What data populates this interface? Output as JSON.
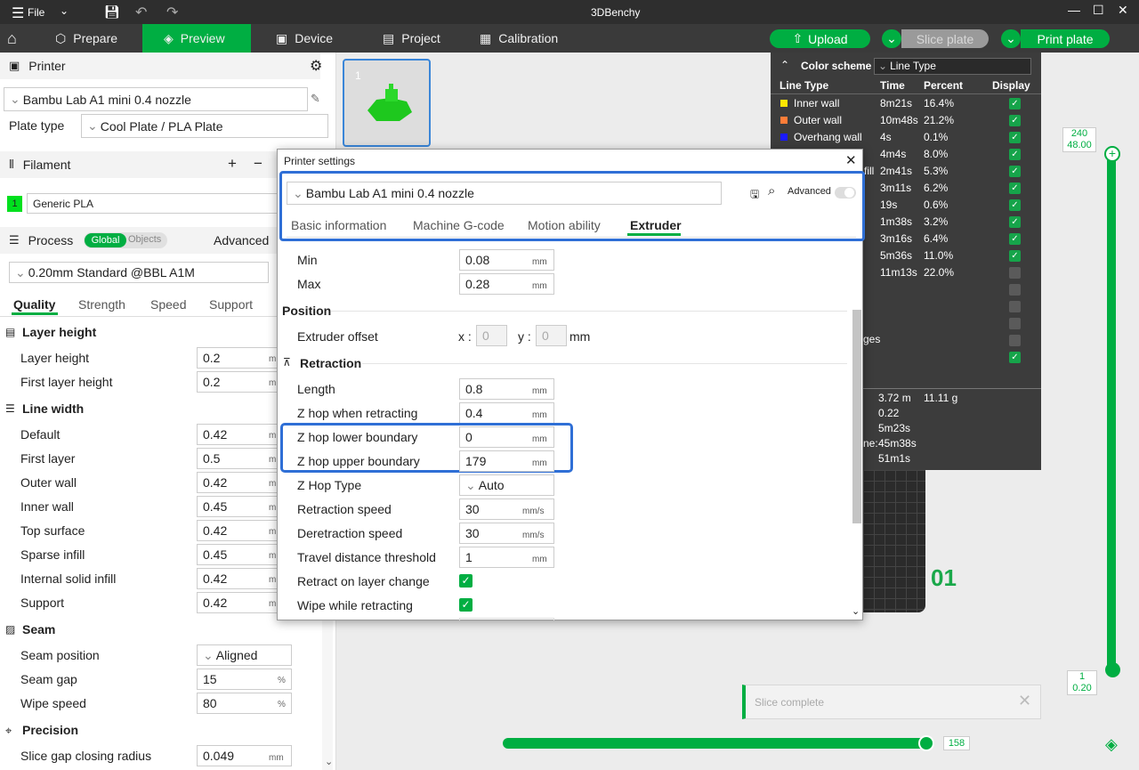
{
  "app": {
    "title": "3DBenchy",
    "file_menu": "File"
  },
  "tabs": [
    {
      "label": "Prepare"
    },
    {
      "label": "Preview"
    },
    {
      "label": "Device"
    },
    {
      "label": "Project"
    },
    {
      "label": "Calibration"
    }
  ],
  "actions": {
    "upload": "Upload",
    "slice_plate": "Slice plate",
    "print_plate": "Print plate"
  },
  "printer": {
    "header": "Printer",
    "name": "Bambu Lab A1 mini 0.4 nozzle",
    "plate_type_label": "Plate type",
    "plate_type_value": "Cool Plate / PLA Plate"
  },
  "filament": {
    "header": "Filament",
    "slot": "1",
    "name": "Generic PLA"
  },
  "process": {
    "header": "Process",
    "global": "Global",
    "objects": "Objects",
    "advanced": "Advanced",
    "preset": "0.20mm Standard @BBL A1M",
    "tabs": [
      "Quality",
      "Strength",
      "Speed",
      "Support"
    ]
  },
  "quality": {
    "layer_height_group": "Layer height",
    "layer_height_label": "Layer height",
    "layer_height_value": "0.2",
    "first_layer_height_label": "First layer height",
    "first_layer_height_value": "0.2",
    "line_width_group": "Line width",
    "lw": [
      {
        "label": "Default",
        "value": "0.42"
      },
      {
        "label": "First layer",
        "value": "0.5"
      },
      {
        "label": "Outer wall",
        "value": "0.42"
      },
      {
        "label": "Inner wall",
        "value": "0.45"
      },
      {
        "label": "Top surface",
        "value": "0.42"
      },
      {
        "label": "Sparse infill",
        "value": "0.45"
      },
      {
        "label": "Internal solid infill",
        "value": "0.42"
      },
      {
        "label": "Support",
        "value": "0.42"
      }
    ],
    "unit_mm": "mm",
    "seam_group": "Seam",
    "seam_position_label": "Seam position",
    "seam_position_value": "Aligned",
    "seam_gap_label": "Seam gap",
    "seam_gap_value": "15",
    "seam_gap_unit": "%",
    "wipe_speed_label": "Wipe speed",
    "wipe_speed_value": "80",
    "wipe_speed_unit": "%",
    "precision_group": "Precision",
    "slice_gap_label": "Slice gap closing radius",
    "slice_gap_value": "0.049"
  },
  "plate_thumb": {
    "number": "1"
  },
  "color_scheme": {
    "title": "Color scheme",
    "mode": "Line Type",
    "headers": {
      "line_type": "Line Type",
      "time": "Time",
      "percent": "Percent",
      "display": "Display"
    },
    "rows": [
      {
        "name": "Inner wall",
        "time": "8m21s",
        "percent": "16.4%",
        "color": "#ffe600"
      },
      {
        "name": "Outer wall",
        "time": "10m48s",
        "percent": "21.2%",
        "color": "#ff7d38"
      },
      {
        "name": "Overhang wall",
        "time": "4s",
        "percent": "0.1%",
        "color": "#1a1aff"
      },
      {
        "name": "",
        "time": "4m4s",
        "percent": "8.0%",
        "color": ""
      },
      {
        "name": "fill",
        "time": "2m41s",
        "percent": "5.3%",
        "color": ""
      },
      {
        "name": "",
        "time": "3m11s",
        "percent": "6.2%",
        "color": ""
      },
      {
        "name": "",
        "time": "19s",
        "percent": "0.6%",
        "color": ""
      },
      {
        "name": "",
        "time": "1m38s",
        "percent": "3.2%",
        "color": ""
      },
      {
        "name": "",
        "time": "3m16s",
        "percent": "6.4%",
        "color": ""
      },
      {
        "name": "",
        "time": "5m36s",
        "percent": "11.0%",
        "color": ""
      },
      {
        "name": "",
        "time": "11m13s",
        "percent": "22.0%",
        "color": ""
      }
    ],
    "partial_label": "ges",
    "summary": [
      {
        "label": "",
        "value": "3.72 m",
        "extra": "11.11 g"
      },
      {
        "label": "",
        "value": "0.22",
        "extra": ""
      },
      {
        "label": "",
        "value": "5m23s",
        "extra": ""
      },
      {
        "label": "ne:",
        "value": "45m38s",
        "extra": ""
      },
      {
        "label": "",
        "value": "51m1s",
        "extra": ""
      }
    ]
  },
  "plate_label": "01",
  "layer_slider": {
    "top_layer": "240",
    "top_height": "48.00",
    "bottom_layer": "1",
    "bottom_height": "0.20"
  },
  "move_slider": {
    "value": "158"
  },
  "notification": {
    "text": "Slice complete"
  },
  "dialog": {
    "title": "Printer settings",
    "preset": "Bambu Lab A1 mini 0.4 nozzle",
    "advanced": "Advanced",
    "tabs": [
      "Basic information",
      "Machine G-code",
      "Motion ability",
      "Extruder"
    ],
    "rows": {
      "min_label": "Min",
      "min_value": "0.08",
      "max_label": "Max",
      "max_value": "0.28",
      "position_group": "Position",
      "extruder_offset_label": "Extruder offset",
      "x_label": "x :",
      "x_value": "0",
      "y_label": "y :",
      "y_value": "0",
      "retraction_group": "Retraction",
      "length_label": "Length",
      "length_value": "0.8",
      "zhop_label": "Z hop when retracting",
      "zhop_value": "0.4",
      "zhop_lower_label": "Z hop lower boundary",
      "zhop_lower_value": "0",
      "zhop_upper_label": "Z hop upper boundary",
      "zhop_upper_value": "179",
      "zhop_type_label": "Z Hop Type",
      "zhop_type_value": "Auto",
      "retract_speed_label": "Retraction speed",
      "retract_speed_value": "30",
      "deretract_speed_label": "Deretraction speed",
      "deretract_speed_value": "30",
      "travel_threshold_label": "Travel distance threshold",
      "travel_threshold_value": "1",
      "retract_layer_change_label": "Retract on layer change",
      "wipe_label": "Wipe while retracting",
      "unit_mm": "mm",
      "unit_mms": "mm/s"
    }
  },
  "colors": {
    "accent": "#00ae42",
    "highlight": "#2f6fd6"
  }
}
